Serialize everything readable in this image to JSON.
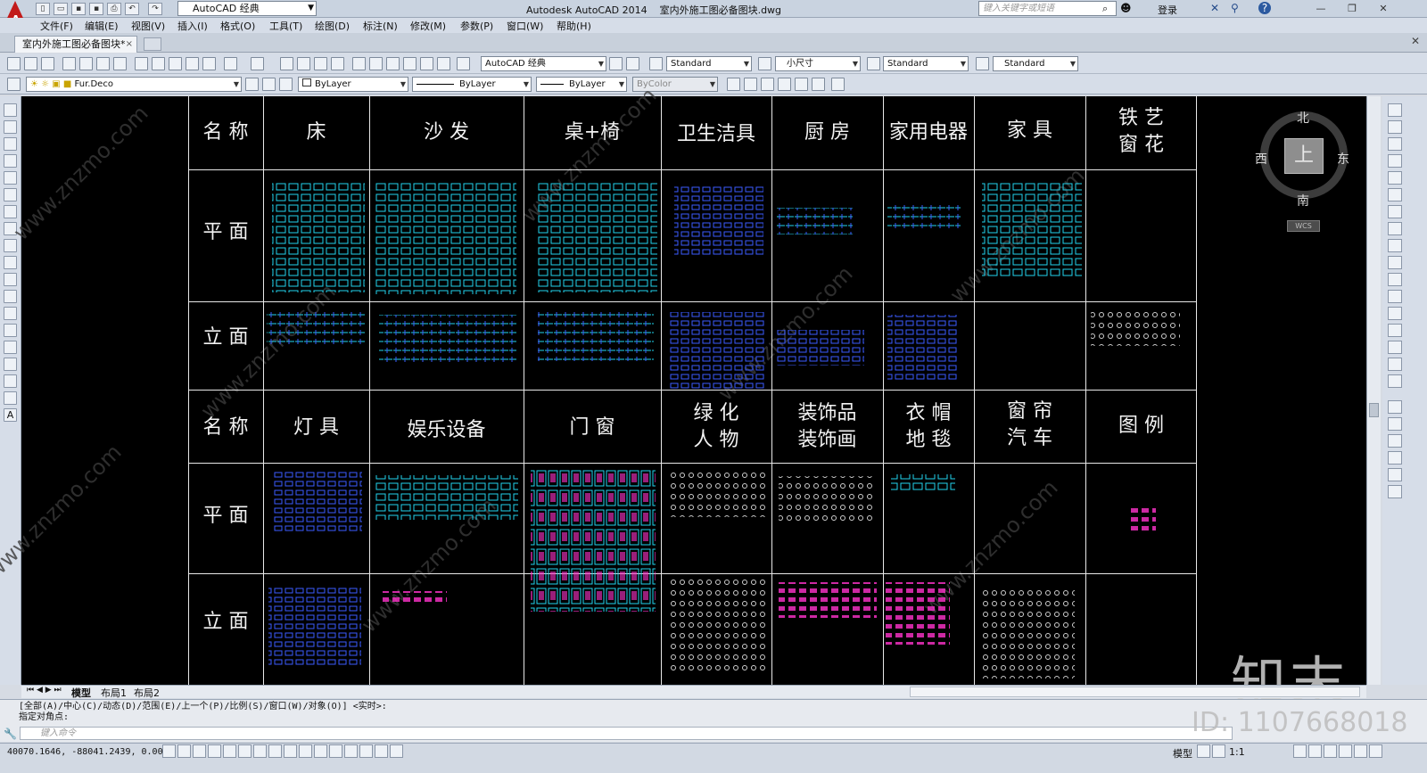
{
  "window": {
    "title": "Autodesk AutoCAD 2014    室内外施工图必备图块.dwg",
    "workspace": "AutoCAD 经典",
    "search_placeholder": "键入关键字或短语",
    "login": "登录",
    "app_icon_letter": "A"
  },
  "menu": [
    "文件(F)",
    "编辑(E)",
    "视图(V)",
    "插入(I)",
    "格式(O)",
    "工具(T)",
    "绘图(D)",
    "标注(N)",
    "修改(M)",
    "参数(P)",
    "窗口(W)",
    "帮助(H)"
  ],
  "doc_tab": {
    "label": "室内外施工图必备图块*",
    "close": "×"
  },
  "toolbar1": {
    "workspace": "AutoCAD 经典",
    "text_style": "Standard",
    "dim_style": "小尺寸",
    "table_style": "Standard",
    "mleader_style": "Standard"
  },
  "toolbar2": {
    "layer": "Fur.Deco",
    "color": "ByLayer",
    "linetype": "ByLayer",
    "lineweight": "ByLayer",
    "plotstyle": "ByColor"
  },
  "grid": {
    "top_headers": [
      "名 称",
      "床",
      "沙 发",
      "桌+椅",
      "卫生洁具",
      "厨 房",
      "家用电器",
      "家 具",
      "铁 艺\n窗 花"
    ],
    "bottom_headers": [
      "名 称",
      "灯 具",
      "娱乐设备",
      "门 窗",
      "绿 化\n人 物",
      "装饰品\n装饰画",
      "衣 帽\n地 毯",
      "窗 帘\n汽 车",
      "图 例"
    ],
    "row_plan": "平 面",
    "row_elev": "立 面"
  },
  "viewcube": {
    "north": "北",
    "south": "南",
    "east": "东",
    "west": "西",
    "face": "上",
    "wcs": "WCS"
  },
  "layout_tabs": [
    "模型",
    "布局1",
    "布局2"
  ],
  "command": {
    "history_line1": "[全部(A)/中心(C)/动态(D)/范围(E)/上一个(P)/比例(S)/窗口(W)/对象(O)] <实时>:",
    "history_line2": "指定对角点:",
    "input_placeholder": "键入命令"
  },
  "status": {
    "coords": "40070.1646,  -88041.2439, 0.0000",
    "model": "模型",
    "scale": "1:1"
  },
  "watermark": {
    "brand": "知末",
    "id": "ID: 1107668018",
    "site": "www.znzmo.com"
  },
  "colors": {
    "canvas": "#000000",
    "cyan": "#22d3ee",
    "blue": "#3b5bff",
    "magenta": "#ff33cc",
    "white": "#e8e8e8"
  }
}
